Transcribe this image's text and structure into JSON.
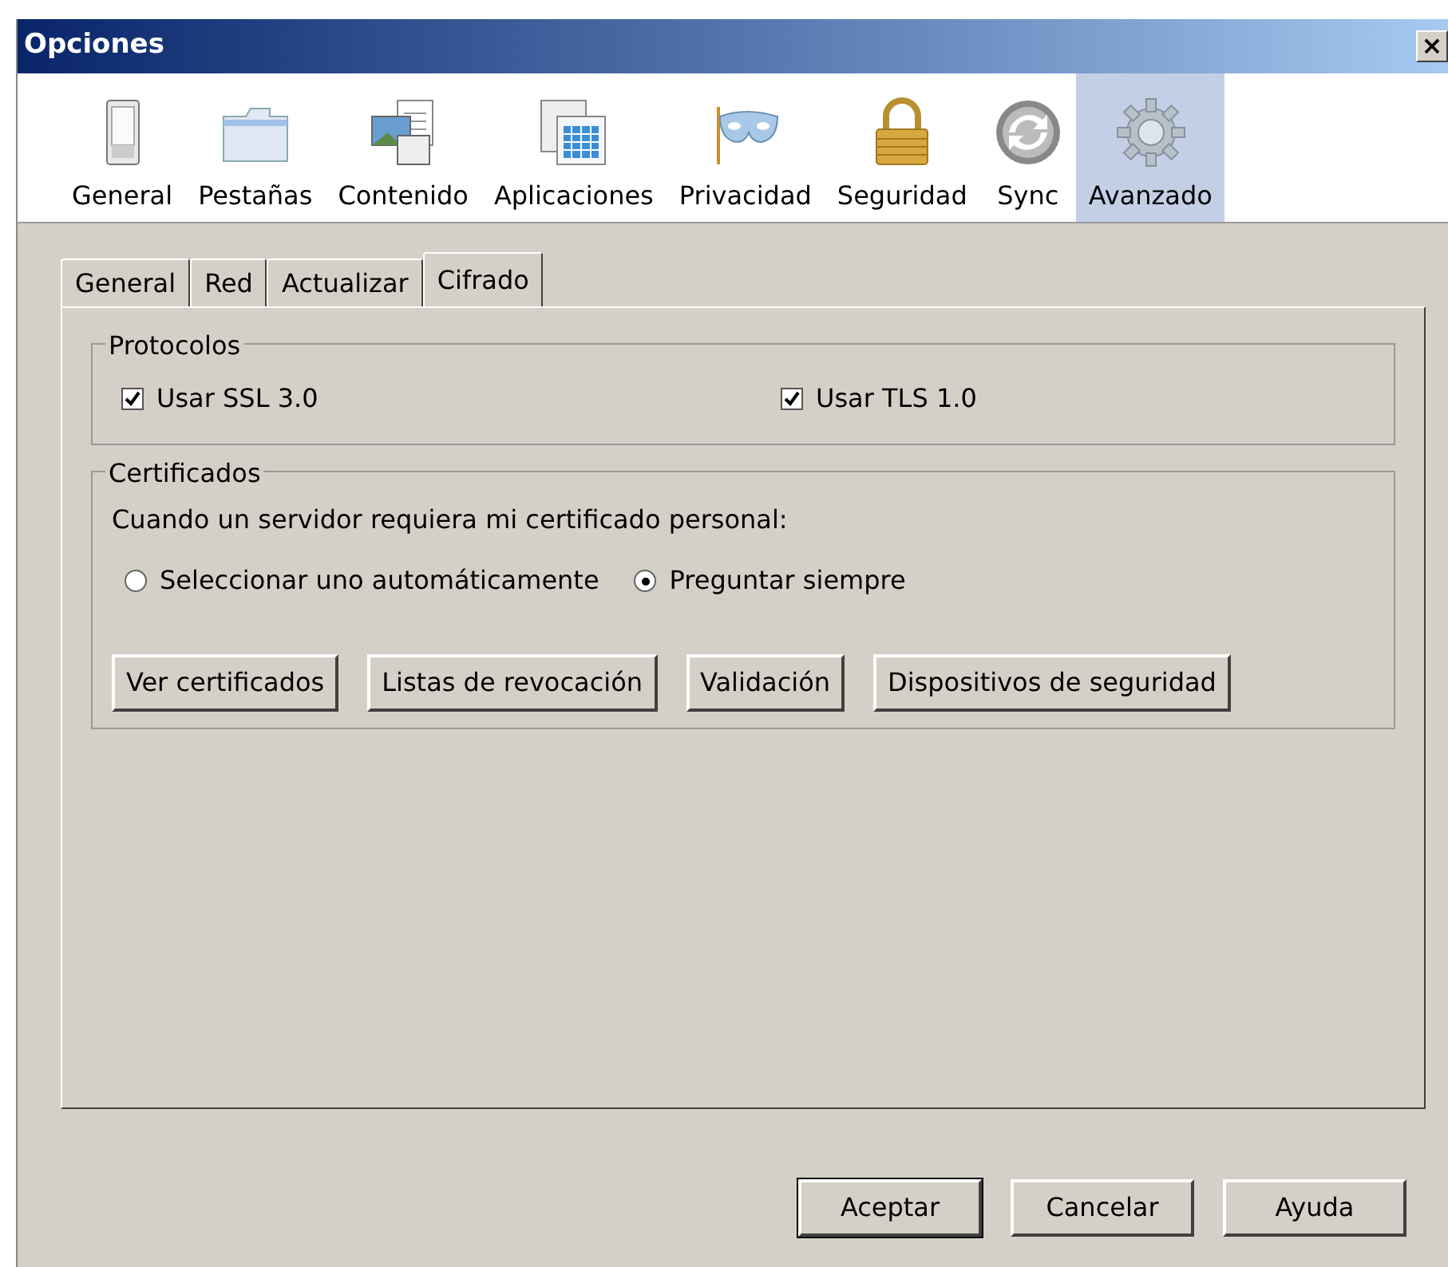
{
  "window": {
    "title": "Opciones",
    "close": "×"
  },
  "panes": [
    {
      "label": "General",
      "kind": "switch",
      "selected": false
    },
    {
      "label": "Pestañas",
      "kind": "folder",
      "selected": false
    },
    {
      "label": "Contenido",
      "kind": "content",
      "selected": false
    },
    {
      "label": "Aplicaciones",
      "kind": "apps",
      "selected": false
    },
    {
      "label": "Privacidad",
      "kind": "mask",
      "selected": false
    },
    {
      "label": "Seguridad",
      "kind": "lock",
      "selected": false
    },
    {
      "label": "Sync",
      "kind": "sync",
      "selected": false
    },
    {
      "label": "Avanzado",
      "kind": "gear",
      "selected": true
    }
  ],
  "tabs": [
    {
      "label": "General",
      "selected": false
    },
    {
      "label": "Red",
      "selected": false
    },
    {
      "label": "Actualizar",
      "selected": false
    },
    {
      "label": "Cifrado",
      "selected": true
    }
  ],
  "protocols": {
    "title": "Protocolos",
    "options": [
      {
        "label": "Usar SSL 3.0",
        "checked": true
      },
      {
        "label": "Usar TLS 1.0",
        "checked": true
      }
    ]
  },
  "certificates": {
    "title": "Certificados",
    "prompt": "Cuando un servidor requiera mi certificado personal:",
    "radios": [
      {
        "label": "Seleccionar uno automáticamente",
        "selected": false
      },
      {
        "label": "Preguntar siempre",
        "selected": true
      }
    ],
    "buttons": [
      "Ver certificados",
      "Listas de revocación",
      "Validación",
      "Dispositivos de seguridad"
    ]
  },
  "footer_buttons": [
    {
      "label": "Aceptar",
      "default": true
    },
    {
      "label": "Cancelar",
      "default": false
    },
    {
      "label": "Ayuda",
      "default": false
    }
  ]
}
